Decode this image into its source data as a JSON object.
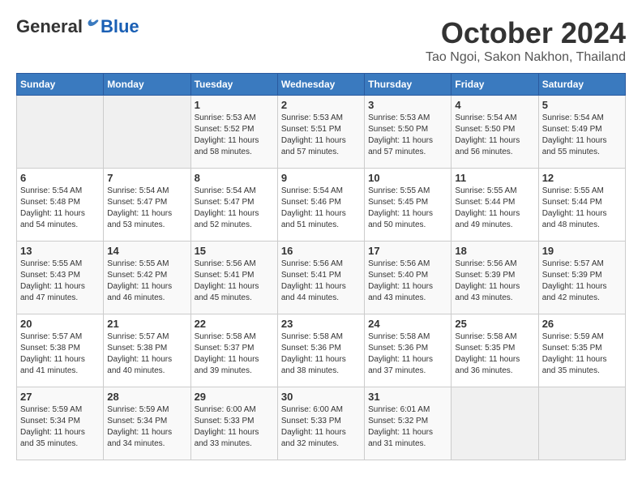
{
  "logo": {
    "general": "General",
    "blue": "Blue"
  },
  "header": {
    "month": "October 2024",
    "location": "Tao Ngoi, Sakon Nakhon, Thailand"
  },
  "weekdays": [
    "Sunday",
    "Monday",
    "Tuesday",
    "Wednesday",
    "Thursday",
    "Friday",
    "Saturday"
  ],
  "weeks": [
    [
      {
        "day": "",
        "info": ""
      },
      {
        "day": "",
        "info": ""
      },
      {
        "day": "1",
        "info": "Sunrise: 5:53 AM\nSunset: 5:52 PM\nDaylight: 11 hours and 58 minutes."
      },
      {
        "day": "2",
        "info": "Sunrise: 5:53 AM\nSunset: 5:51 PM\nDaylight: 11 hours and 57 minutes."
      },
      {
        "day": "3",
        "info": "Sunrise: 5:53 AM\nSunset: 5:50 PM\nDaylight: 11 hours and 57 minutes."
      },
      {
        "day": "4",
        "info": "Sunrise: 5:54 AM\nSunset: 5:50 PM\nDaylight: 11 hours and 56 minutes."
      },
      {
        "day": "5",
        "info": "Sunrise: 5:54 AM\nSunset: 5:49 PM\nDaylight: 11 hours and 55 minutes."
      }
    ],
    [
      {
        "day": "6",
        "info": "Sunrise: 5:54 AM\nSunset: 5:48 PM\nDaylight: 11 hours and 54 minutes."
      },
      {
        "day": "7",
        "info": "Sunrise: 5:54 AM\nSunset: 5:47 PM\nDaylight: 11 hours and 53 minutes."
      },
      {
        "day": "8",
        "info": "Sunrise: 5:54 AM\nSunset: 5:47 PM\nDaylight: 11 hours and 52 minutes."
      },
      {
        "day": "9",
        "info": "Sunrise: 5:54 AM\nSunset: 5:46 PM\nDaylight: 11 hours and 51 minutes."
      },
      {
        "day": "10",
        "info": "Sunrise: 5:55 AM\nSunset: 5:45 PM\nDaylight: 11 hours and 50 minutes."
      },
      {
        "day": "11",
        "info": "Sunrise: 5:55 AM\nSunset: 5:44 PM\nDaylight: 11 hours and 49 minutes."
      },
      {
        "day": "12",
        "info": "Sunrise: 5:55 AM\nSunset: 5:44 PM\nDaylight: 11 hours and 48 minutes."
      }
    ],
    [
      {
        "day": "13",
        "info": "Sunrise: 5:55 AM\nSunset: 5:43 PM\nDaylight: 11 hours and 47 minutes."
      },
      {
        "day": "14",
        "info": "Sunrise: 5:55 AM\nSunset: 5:42 PM\nDaylight: 11 hours and 46 minutes."
      },
      {
        "day": "15",
        "info": "Sunrise: 5:56 AM\nSunset: 5:41 PM\nDaylight: 11 hours and 45 minutes."
      },
      {
        "day": "16",
        "info": "Sunrise: 5:56 AM\nSunset: 5:41 PM\nDaylight: 11 hours and 44 minutes."
      },
      {
        "day": "17",
        "info": "Sunrise: 5:56 AM\nSunset: 5:40 PM\nDaylight: 11 hours and 43 minutes."
      },
      {
        "day": "18",
        "info": "Sunrise: 5:56 AM\nSunset: 5:39 PM\nDaylight: 11 hours and 43 minutes."
      },
      {
        "day": "19",
        "info": "Sunrise: 5:57 AM\nSunset: 5:39 PM\nDaylight: 11 hours and 42 minutes."
      }
    ],
    [
      {
        "day": "20",
        "info": "Sunrise: 5:57 AM\nSunset: 5:38 PM\nDaylight: 11 hours and 41 minutes."
      },
      {
        "day": "21",
        "info": "Sunrise: 5:57 AM\nSunset: 5:38 PM\nDaylight: 11 hours and 40 minutes."
      },
      {
        "day": "22",
        "info": "Sunrise: 5:58 AM\nSunset: 5:37 PM\nDaylight: 11 hours and 39 minutes."
      },
      {
        "day": "23",
        "info": "Sunrise: 5:58 AM\nSunset: 5:36 PM\nDaylight: 11 hours and 38 minutes."
      },
      {
        "day": "24",
        "info": "Sunrise: 5:58 AM\nSunset: 5:36 PM\nDaylight: 11 hours and 37 minutes."
      },
      {
        "day": "25",
        "info": "Sunrise: 5:58 AM\nSunset: 5:35 PM\nDaylight: 11 hours and 36 minutes."
      },
      {
        "day": "26",
        "info": "Sunrise: 5:59 AM\nSunset: 5:35 PM\nDaylight: 11 hours and 35 minutes."
      }
    ],
    [
      {
        "day": "27",
        "info": "Sunrise: 5:59 AM\nSunset: 5:34 PM\nDaylight: 11 hours and 35 minutes."
      },
      {
        "day": "28",
        "info": "Sunrise: 5:59 AM\nSunset: 5:34 PM\nDaylight: 11 hours and 34 minutes."
      },
      {
        "day": "29",
        "info": "Sunrise: 6:00 AM\nSunset: 5:33 PM\nDaylight: 11 hours and 33 minutes."
      },
      {
        "day": "30",
        "info": "Sunrise: 6:00 AM\nSunset: 5:33 PM\nDaylight: 11 hours and 32 minutes."
      },
      {
        "day": "31",
        "info": "Sunrise: 6:01 AM\nSunset: 5:32 PM\nDaylight: 11 hours and 31 minutes."
      },
      {
        "day": "",
        "info": ""
      },
      {
        "day": "",
        "info": ""
      }
    ]
  ]
}
